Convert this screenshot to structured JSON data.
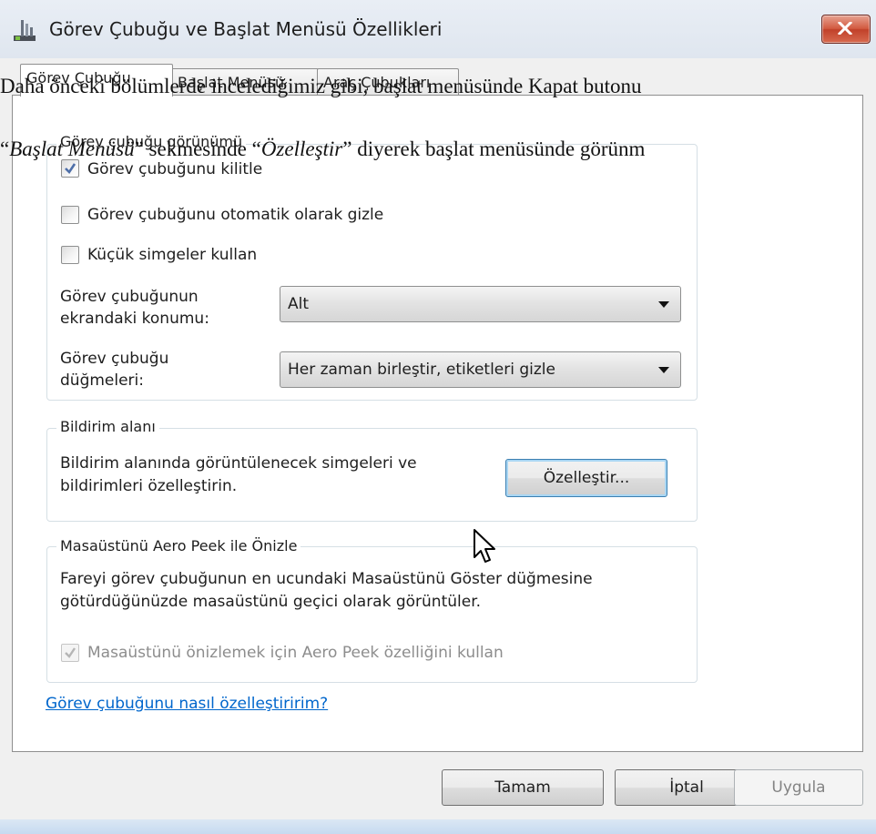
{
  "window": {
    "title": "Görev Çubuğu ve Başlat Menüsü Özellikleri"
  },
  "tabs": [
    {
      "label": "Görev Çubuğu",
      "active": true
    },
    {
      "label": "Başlat Menüsü",
      "active": false
    },
    {
      "label": "Araç Çubukları",
      "active": false
    }
  ],
  "taskbar_appearance": {
    "title": "Görev çubuğu görünümü",
    "lock_label": "Görev çubuğunu kilitle",
    "lock_checked": true,
    "autohide_label": "Görev çubuğunu otomatik olarak gizle",
    "autohide_checked": false,
    "small_icons_label": "Küçük simgeler kullan",
    "small_icons_checked": false,
    "location_label_line1": "Görev çubuğunun",
    "location_label_line2": "ekrandaki konumu:",
    "location_value": "Alt",
    "buttons_label_line1": "Görev çubuğu",
    "buttons_label_line2": "düğmeleri:",
    "buttons_value": "Her zaman birleştir, etiketleri gizle"
  },
  "notification_area": {
    "title": "Bildirim alanı",
    "desc_line1": "Bildirim alanında görüntülenecek simgeleri ve",
    "desc_line2": "bildirimleri özelleştirin.",
    "customize_label": "Özelleştir..."
  },
  "aero_peek": {
    "title": "Masaüstünü Aero Peek ile Önizle",
    "desc_line1": "Fareyi görev çubuğunun en ucundaki Masaüstünü Göster düğmesine",
    "desc_line2": "götürdüğünüzde masaüstünü geçici olarak görüntüler.",
    "checkbox_label": "Masaüstünü önizlemek için Aero Peek özelliğini kullan",
    "checkbox_checked": true,
    "checkbox_enabled": false
  },
  "help_link": "Görev çubuğunu nasıl özelleştiririm?",
  "footer": {
    "ok_label": "Tamam",
    "cancel_label": "İptal",
    "apply_label": "Uygula"
  },
  "overlay_text": {
    "line1": "Daha önceki bölümlerde incelediğimiz gibi, başlat menüsünde Kapat butonu",
    "line2_q1": "“",
    "line2_italic1": "Başlat Menüsü",
    "line2_mid": "” sekmesinde “",
    "line2_italic2": "Özelleştir",
    "line2_end": "” diyerek başlat menüsünde görünm"
  },
  "colors": {
    "close_button": "#c1412a",
    "link": "#0066cc",
    "focus_border": "#3c7fb1"
  },
  "icons": [
    "taskbar-app-icon",
    "close-x-icon",
    "checkmark-icon",
    "dropdown-arrow-icon",
    "mouse-pointer-icon"
  ]
}
